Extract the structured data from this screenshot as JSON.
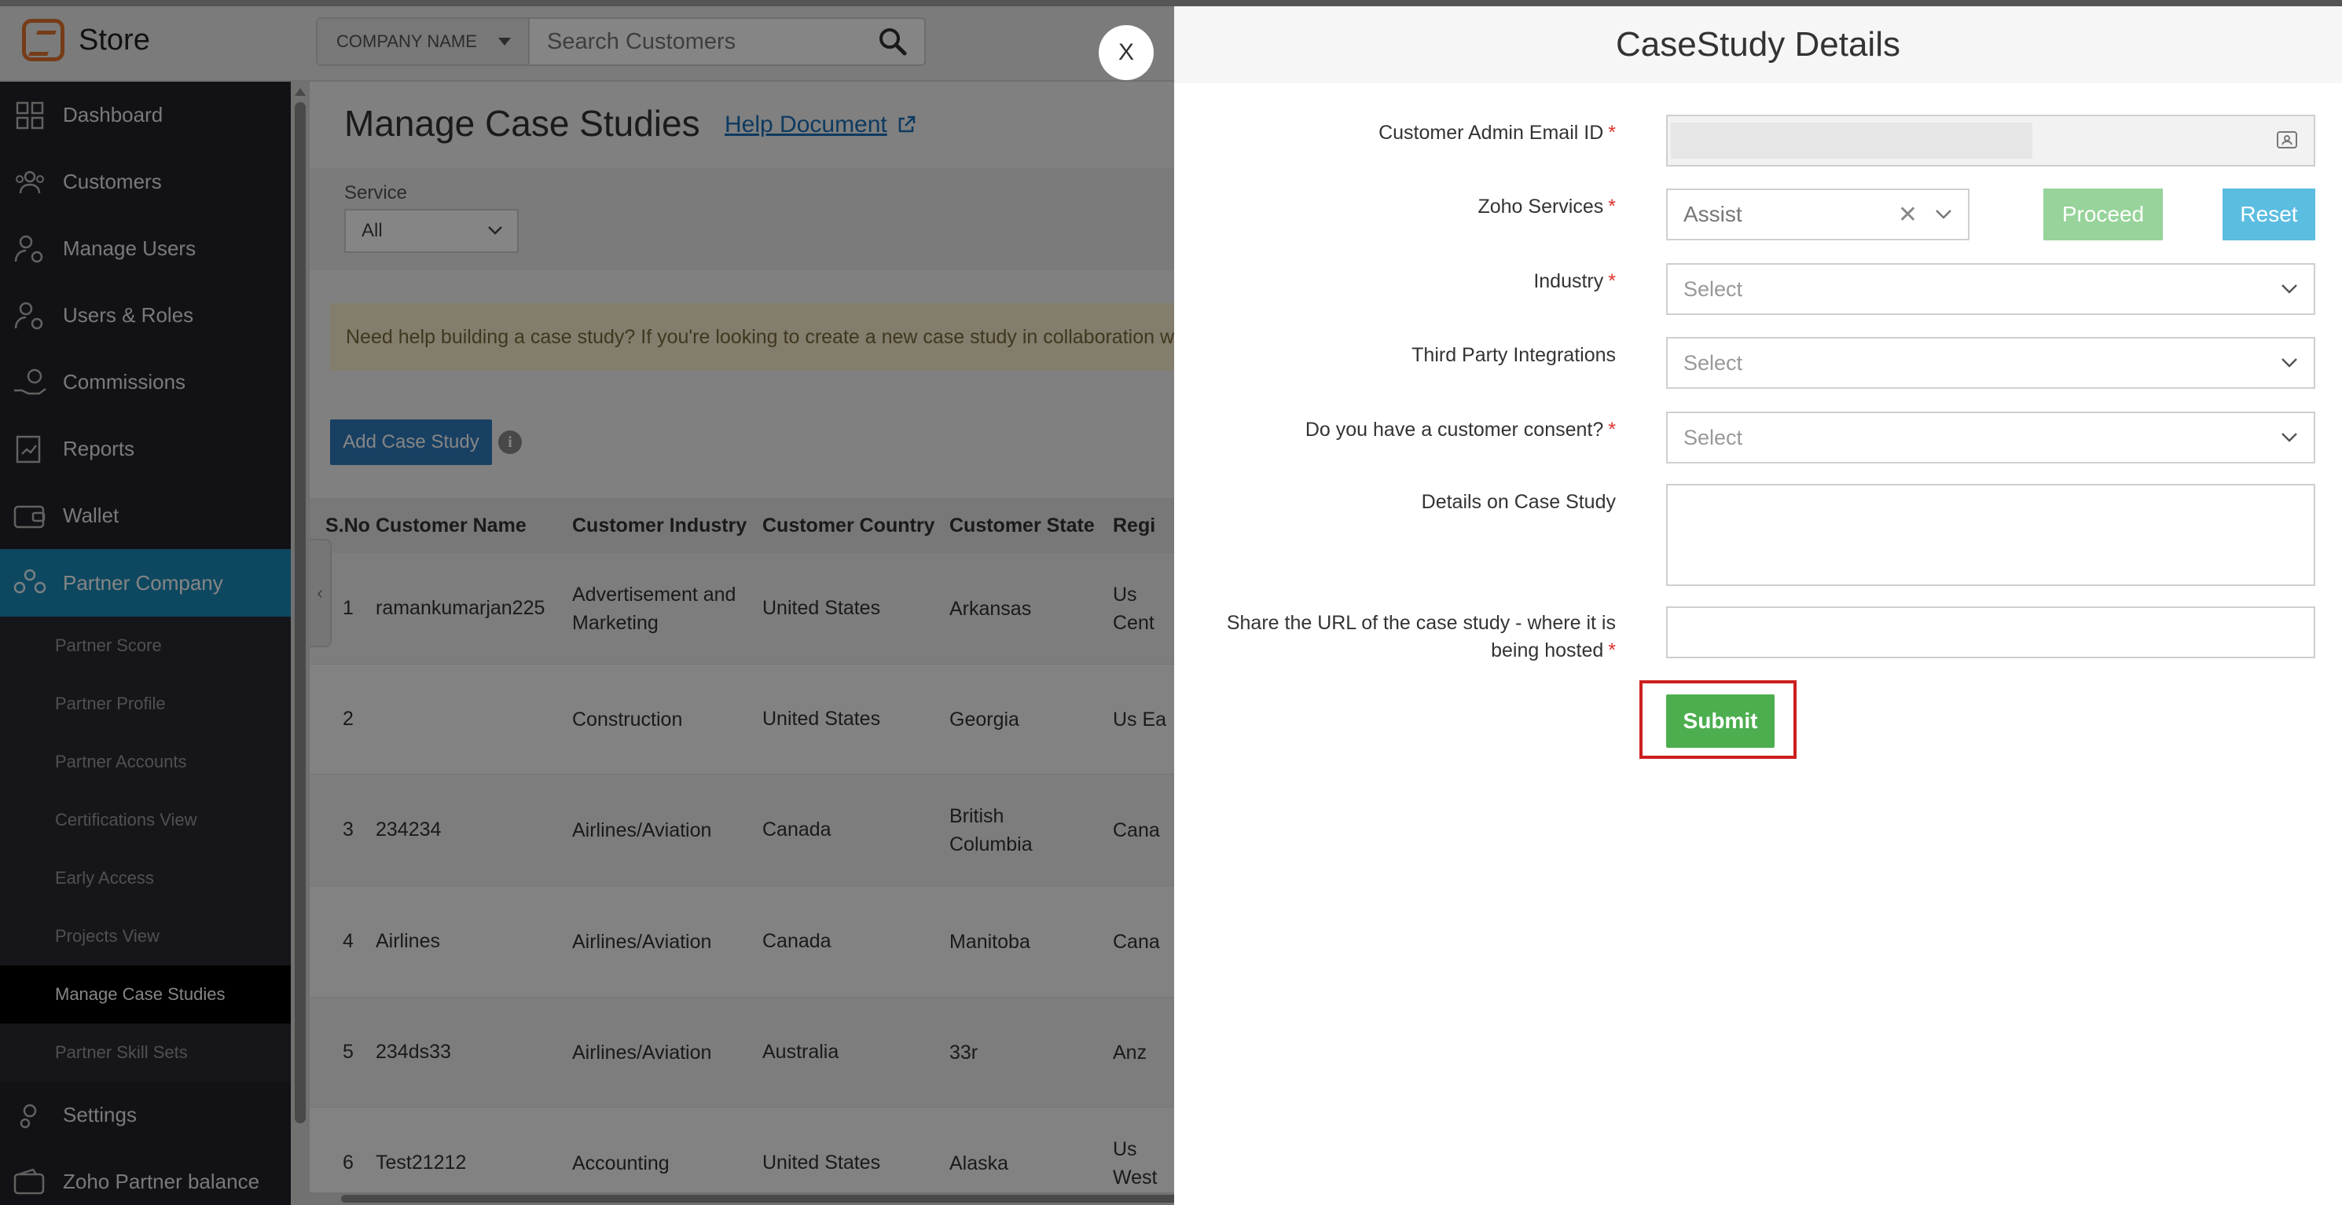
{
  "app": {
    "brand": "Store"
  },
  "search": {
    "company_filter": "COMPANY NAME",
    "placeholder": "Search Customers"
  },
  "sidebar": {
    "items": [
      {
        "label": "Dashboard",
        "icon": "grid-icon"
      },
      {
        "label": "Customers",
        "icon": "people-icon"
      },
      {
        "label": "Manage Users",
        "icon": "user-gear-icon"
      },
      {
        "label": "Users & Roles",
        "icon": "user-roles-icon"
      },
      {
        "label": "Commissions",
        "icon": "hand-coins-icon"
      },
      {
        "label": "Reports",
        "icon": "report-icon"
      },
      {
        "label": "Wallet",
        "icon": "wallet-icon"
      },
      {
        "label": "Partner Company",
        "icon": "partner-icon",
        "active": true
      }
    ],
    "submenu": [
      "Partner Score",
      "Partner Profile",
      "Partner Accounts",
      "Certifications View",
      "Early Access",
      "Projects View",
      "Manage Case Studies",
      "Partner Skill Sets"
    ],
    "current_submenu": "Manage Case Studies",
    "bottom": [
      {
        "label": "Settings",
        "icon": "settings-icon"
      },
      {
        "label": "Zoho Partner balance",
        "icon": "balance-wallet-icon"
      }
    ]
  },
  "main": {
    "title": "Manage Case Studies",
    "help_link": "Help Document",
    "filter_label": "Service",
    "filter_value": "All",
    "banner": "Need help building a case study? If you're looking to create a new case study in collaboration w",
    "add_button": "Add Case Study",
    "info": "i",
    "columns": [
      "S.No",
      "Customer Name",
      "Customer Industry",
      "Customer Country",
      "Customer State",
      "Regi"
    ],
    "rows": [
      [
        "1",
        "ramankumarjan225",
        "Advertisement and Marketing",
        "United States",
        "Arkansas",
        "Us Cent"
      ],
      [
        "2",
        "",
        "Construction",
        "United States",
        "Georgia",
        "Us Ea"
      ],
      [
        "3",
        "234234",
        "Airlines/Aviation",
        "Canada",
        "British Columbia",
        "Cana"
      ],
      [
        "4",
        "Airlines",
        "Airlines/Aviation",
        "Canada",
        "Manitoba",
        "Cana"
      ],
      [
        "5",
        "234ds33",
        "Airlines/Aviation",
        "Australia",
        "33r",
        "Anz"
      ],
      [
        "6",
        "Test21212",
        "Accounting",
        "United States",
        "Alaska",
        "Us West"
      ]
    ]
  },
  "modal": {
    "close_label": "X",
    "title": "CaseStudy Details",
    "labels": {
      "email": "Customer Admin Email ID",
      "services": "Zoho Services",
      "industry": "Industry",
      "integrations": "Third Party Integrations",
      "consent": "Do you have a customer consent?",
      "details": "Details on Case Study",
      "url": "Share the URL of the case study - where it is being hosted"
    },
    "required_mark": "*",
    "services_value": "Assist",
    "select_placeholder": "Select",
    "proceed": "Proceed",
    "reset": "Reset",
    "submit": "Submit"
  },
  "colors": {
    "sidebar_bg": "#23232b",
    "active_nav": "#1c8bb8",
    "submit_green": "#4cae4f",
    "proceed_green": "#97d39a",
    "reset_blue": "#5bbde0",
    "highlight_red": "#cc1f1f",
    "required_red": "#d9352d"
  }
}
